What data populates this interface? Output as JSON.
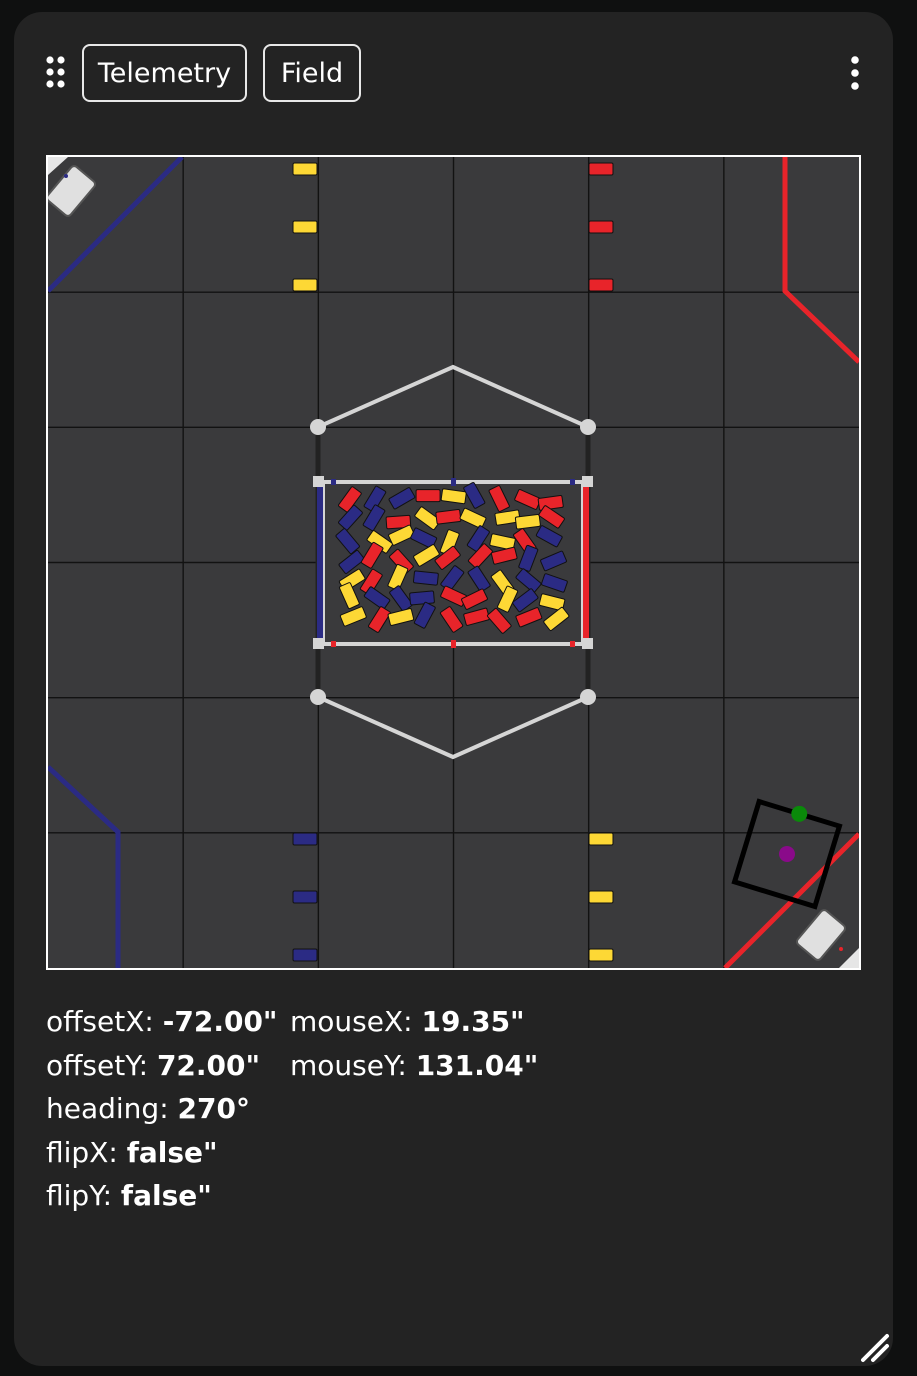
{
  "tabs": [
    {
      "label": "Telemetry"
    },
    {
      "label": "Field"
    }
  ],
  "icons": {
    "drag": "drag-handle-icon",
    "menu": "vertical-dots-menu-icon",
    "resize": "resize-corner-icon"
  },
  "colors": {
    "panel": "#232323",
    "field_tile": "#3a3a3c",
    "alliance_red": "#e8242a",
    "alliance_blue": "#2b2b84",
    "sample_yellow": "#fdd835",
    "robot_heading_marker": "#0a8a0a",
    "robot_center_marker": "#8a0a8a"
  },
  "readouts": {
    "left": [
      {
        "label": "offsetX: ",
        "value": "-72.00\""
      },
      {
        "label": "offsetY: ",
        "value": "72.00\""
      },
      {
        "label": "heading: ",
        "value": "270°"
      },
      {
        "label": "flipX: ",
        "value": "false\""
      },
      {
        "label": "flipY: ",
        "value": "false\""
      }
    ],
    "right": [
      {
        "label": "mouseX: ",
        "value": "19.35\""
      },
      {
        "label": "mouseY: ",
        "value": "131.04\""
      }
    ]
  }
}
